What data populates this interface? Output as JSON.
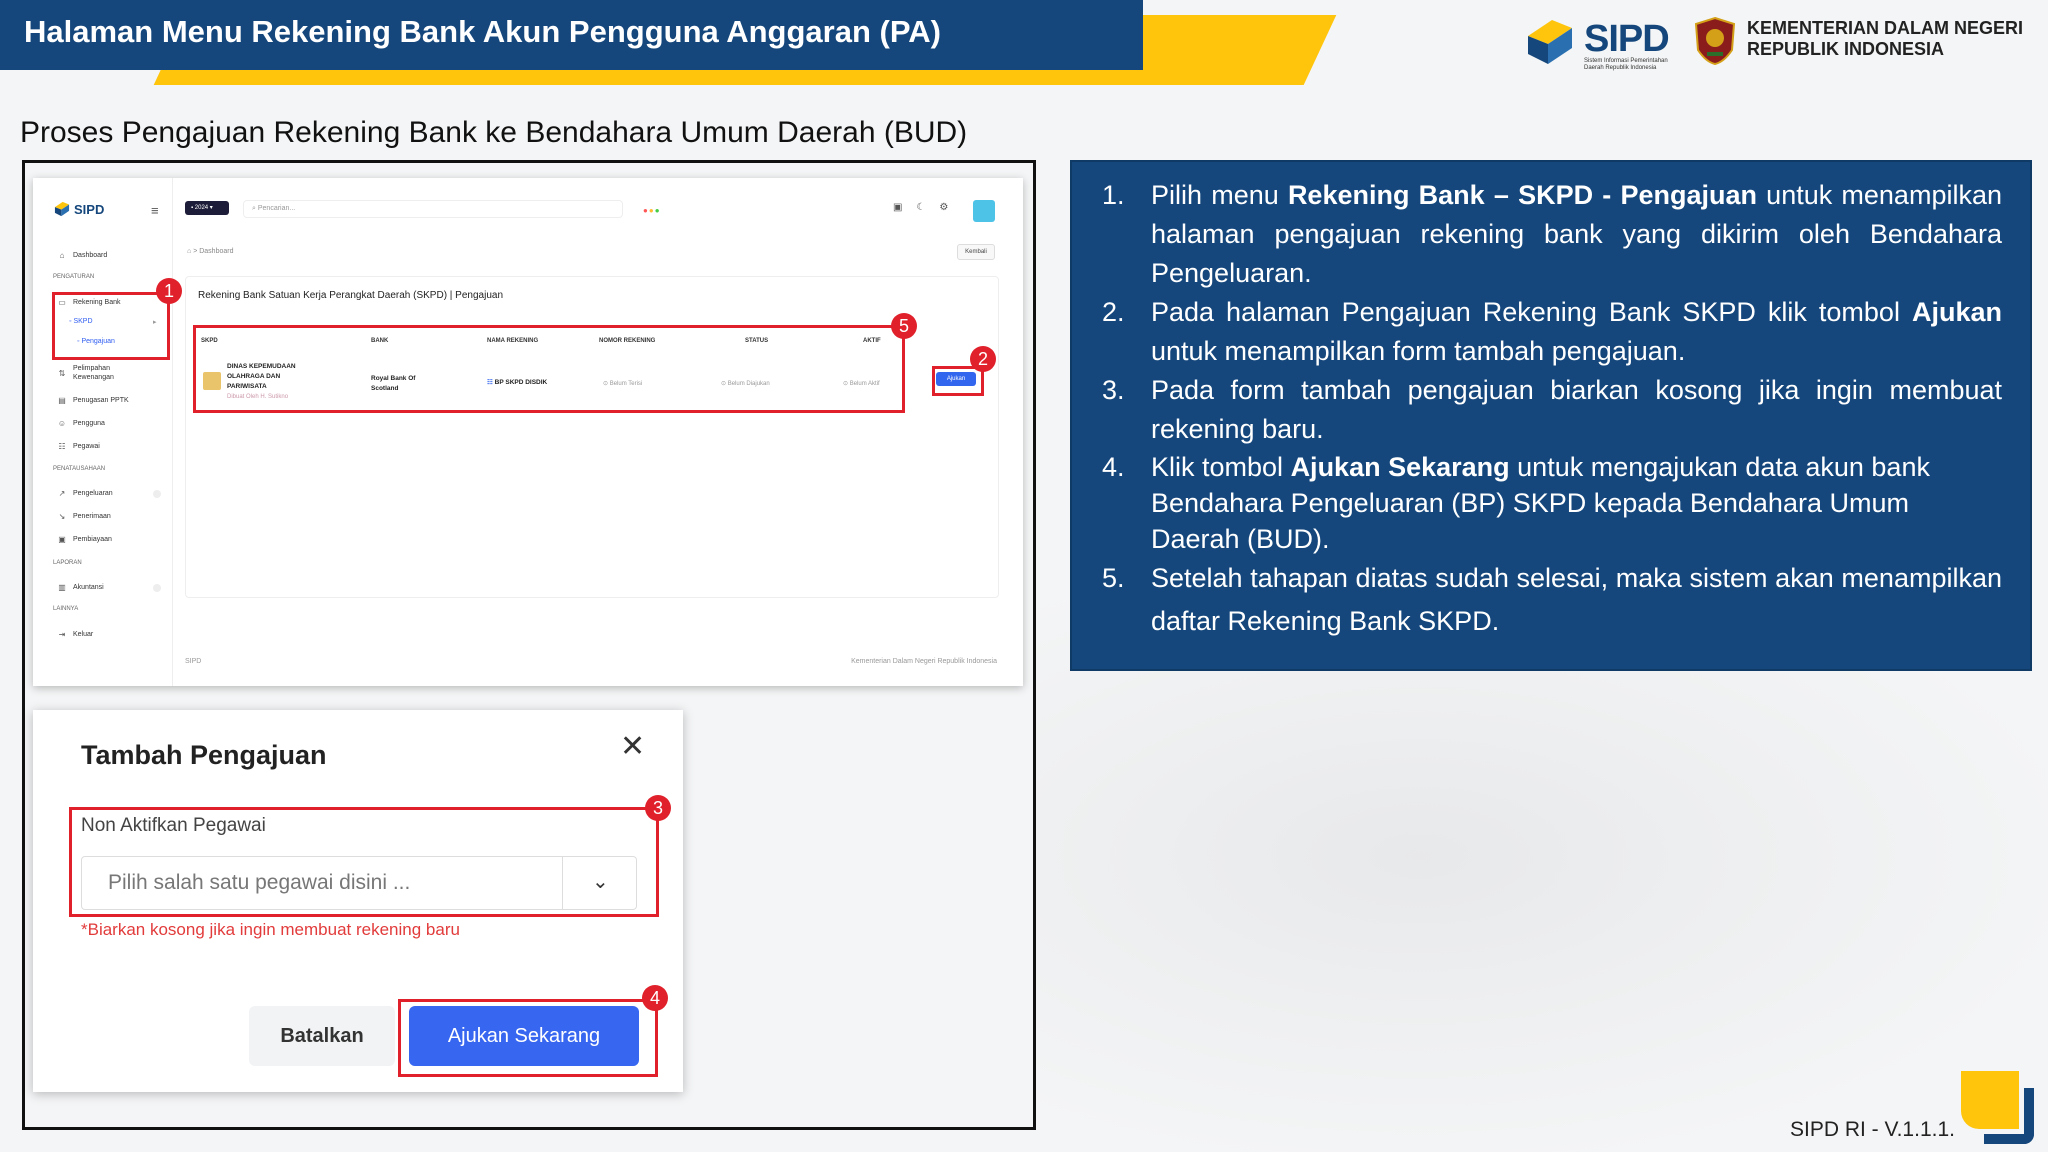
{
  "header": {
    "title": "Halaman Menu Rekening Bank Akun Pengguna Anggaran (PA)",
    "sipd_logo": "SIPD",
    "sipd_sub": "Sistem Informasi Pemerintahan Daerah Republik Indonesia",
    "kementerian": "KEMENTERIAN DALAM NEGERI\nREPUBLIK INDONESIA"
  },
  "subtitle": "Proses Pengajuan Rekening Bank ke Bendahara Umum Daerah (BUD)",
  "app": {
    "logo": "SIPD",
    "year_badge": "▪ 2024 ▾",
    "search_placeholder": "Pencarian...",
    "breadcrumb_sep": ">",
    "breadcrumb": "Dashboard",
    "back_button": "Kembali",
    "sidebar": {
      "dashboard": "Dashboard",
      "sec_pengaturan": "PENGATURAN",
      "rekening_bank": "Rekening Bank",
      "skpd": "SKPD",
      "pengajuan": "Pengajuan",
      "pelimpahan": "Pelimpahan\nKewenangan",
      "penugasan": "Penugasan PPTK",
      "pengguna": "Pengguna",
      "pegawai": "Pegawai",
      "sec_penatausahaan": "PENATAUSAHAAN",
      "pengeluaran": "Pengeluaran",
      "penerimaan": "Penerimaan",
      "pembiayaan": "Pembiayaan",
      "sec_laporan": "LAPORAN",
      "akuntansi": "Akuntansi",
      "sec_lainnya": "LAINNYA",
      "keluar": "Keluar"
    },
    "card_title": "Rekening Bank Satuan Kerja Perangkat Daerah (SKPD) | Pengajuan",
    "table": {
      "headers": [
        "SKPD",
        "BANK",
        "NAMA REKENING",
        "NOMOR REKENING",
        "STATUS",
        "AKTIF"
      ],
      "row": {
        "skpd": "DINAS KEPEMUDAAN\nOLAHRAGA DAN\nPARIWISATA",
        "skpd_sub": "Dibuat Oleh H. Sutikno",
        "bank": "Royal Bank Of\nScotland",
        "nama_rekening": "BP SKPD DISDIK",
        "nomor_rekening": "⊙ Belum Terisi",
        "status": "⊙ Belum Diajukan",
        "aktif": "⊙ Belum Aktif"
      }
    },
    "ajukan_button": "Ajukan",
    "footer_left": "SIPD",
    "footer_right": "Kementerian Dalam Negeri Republik Indonesia"
  },
  "modal": {
    "title": "Tambah Pengajuan",
    "close": "✕",
    "field_label": "Non Aktifkan Pegawai",
    "select_placeholder": "Pilih salah satu pegawai disini ...",
    "hint": "*Biarkan kosong jika ingin membuat rekening baru",
    "cancel": "Batalkan",
    "submit": "Ajukan Sekarang"
  },
  "badges": [
    "1",
    "2",
    "3",
    "4",
    "5"
  ],
  "steps": [
    {
      "num": "1.",
      "pre": "Pilih menu ",
      "bold": "Rekening Bank – SKPD - Pengajuan",
      "post": " untuk menampilkan halaman pengajuan rekening bank yang dikirim oleh Bendahara Pengeluaran."
    },
    {
      "num": "2.",
      "pre": "Pada halaman Pengajuan Rekening Bank SKPD klik tombol ",
      "bold": "Ajukan",
      "post": " untuk menampilkan form tambah pengajuan."
    },
    {
      "num": "3.",
      "pre": "Pada form tambah pengajuan biarkan kosong jika ingin membuat rekening baru.",
      "bold": "",
      "post": ""
    },
    {
      "num": "4.",
      "pre": "Klik tombol ",
      "bold": "Ajukan Sekarang",
      "post": " untuk mengajukan data akun bank Bendahara Pengeluaran (BP) SKPD kepada Bendahara Umum Daerah (BUD)."
    },
    {
      "num": "5.",
      "pre": "Setelah tahapan diatas sudah selesai, maka sistem akan menampilkan daftar Rekening Bank SKPD.",
      "bold": "",
      "post": ""
    }
  ],
  "version": "SIPD RI - V.1.1.1.",
  "colors": {
    "primary": "#15477c",
    "accent": "#ffc50d",
    "highlight": "#e0202a",
    "button": "#3766f0"
  }
}
